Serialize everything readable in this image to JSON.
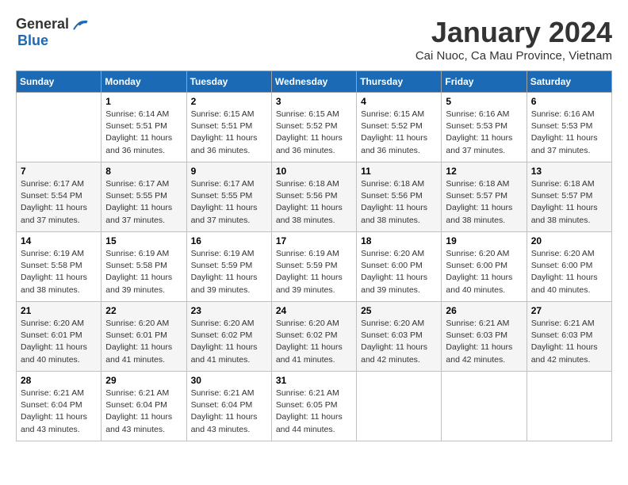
{
  "header": {
    "logo_general": "General",
    "logo_blue": "Blue",
    "month": "January 2024",
    "location": "Cai Nuoc, Ca Mau Province, Vietnam"
  },
  "days_of_week": [
    "Sunday",
    "Monday",
    "Tuesday",
    "Wednesday",
    "Thursday",
    "Friday",
    "Saturday"
  ],
  "weeks": [
    [
      {
        "day": "",
        "sunrise": "",
        "sunset": "",
        "daylight": ""
      },
      {
        "day": "1",
        "sunrise": "Sunrise: 6:14 AM",
        "sunset": "Sunset: 5:51 PM",
        "daylight": "Daylight: 11 hours and 36 minutes."
      },
      {
        "day": "2",
        "sunrise": "Sunrise: 6:15 AM",
        "sunset": "Sunset: 5:51 PM",
        "daylight": "Daylight: 11 hours and 36 minutes."
      },
      {
        "day": "3",
        "sunrise": "Sunrise: 6:15 AM",
        "sunset": "Sunset: 5:52 PM",
        "daylight": "Daylight: 11 hours and 36 minutes."
      },
      {
        "day": "4",
        "sunrise": "Sunrise: 6:15 AM",
        "sunset": "Sunset: 5:52 PM",
        "daylight": "Daylight: 11 hours and 36 minutes."
      },
      {
        "day": "5",
        "sunrise": "Sunrise: 6:16 AM",
        "sunset": "Sunset: 5:53 PM",
        "daylight": "Daylight: 11 hours and 37 minutes."
      },
      {
        "day": "6",
        "sunrise": "Sunrise: 6:16 AM",
        "sunset": "Sunset: 5:53 PM",
        "daylight": "Daylight: 11 hours and 37 minutes."
      }
    ],
    [
      {
        "day": "7",
        "sunrise": "Sunrise: 6:17 AM",
        "sunset": "Sunset: 5:54 PM",
        "daylight": "Daylight: 11 hours and 37 minutes."
      },
      {
        "day": "8",
        "sunrise": "Sunrise: 6:17 AM",
        "sunset": "Sunset: 5:55 PM",
        "daylight": "Daylight: 11 hours and 37 minutes."
      },
      {
        "day": "9",
        "sunrise": "Sunrise: 6:17 AM",
        "sunset": "Sunset: 5:55 PM",
        "daylight": "Daylight: 11 hours and 37 minutes."
      },
      {
        "day": "10",
        "sunrise": "Sunrise: 6:18 AM",
        "sunset": "Sunset: 5:56 PM",
        "daylight": "Daylight: 11 hours and 38 minutes."
      },
      {
        "day": "11",
        "sunrise": "Sunrise: 6:18 AM",
        "sunset": "Sunset: 5:56 PM",
        "daylight": "Daylight: 11 hours and 38 minutes."
      },
      {
        "day": "12",
        "sunrise": "Sunrise: 6:18 AM",
        "sunset": "Sunset: 5:57 PM",
        "daylight": "Daylight: 11 hours and 38 minutes."
      },
      {
        "day": "13",
        "sunrise": "Sunrise: 6:18 AM",
        "sunset": "Sunset: 5:57 PM",
        "daylight": "Daylight: 11 hours and 38 minutes."
      }
    ],
    [
      {
        "day": "14",
        "sunrise": "Sunrise: 6:19 AM",
        "sunset": "Sunset: 5:58 PM",
        "daylight": "Daylight: 11 hours and 38 minutes."
      },
      {
        "day": "15",
        "sunrise": "Sunrise: 6:19 AM",
        "sunset": "Sunset: 5:58 PM",
        "daylight": "Daylight: 11 hours and 39 minutes."
      },
      {
        "day": "16",
        "sunrise": "Sunrise: 6:19 AM",
        "sunset": "Sunset: 5:59 PM",
        "daylight": "Daylight: 11 hours and 39 minutes."
      },
      {
        "day": "17",
        "sunrise": "Sunrise: 6:19 AM",
        "sunset": "Sunset: 5:59 PM",
        "daylight": "Daylight: 11 hours and 39 minutes."
      },
      {
        "day": "18",
        "sunrise": "Sunrise: 6:20 AM",
        "sunset": "Sunset: 6:00 PM",
        "daylight": "Daylight: 11 hours and 39 minutes."
      },
      {
        "day": "19",
        "sunrise": "Sunrise: 6:20 AM",
        "sunset": "Sunset: 6:00 PM",
        "daylight": "Daylight: 11 hours and 40 minutes."
      },
      {
        "day": "20",
        "sunrise": "Sunrise: 6:20 AM",
        "sunset": "Sunset: 6:00 PM",
        "daylight": "Daylight: 11 hours and 40 minutes."
      }
    ],
    [
      {
        "day": "21",
        "sunrise": "Sunrise: 6:20 AM",
        "sunset": "Sunset: 6:01 PM",
        "daylight": "Daylight: 11 hours and 40 minutes."
      },
      {
        "day": "22",
        "sunrise": "Sunrise: 6:20 AM",
        "sunset": "Sunset: 6:01 PM",
        "daylight": "Daylight: 11 hours and 41 minutes."
      },
      {
        "day": "23",
        "sunrise": "Sunrise: 6:20 AM",
        "sunset": "Sunset: 6:02 PM",
        "daylight": "Daylight: 11 hours and 41 minutes."
      },
      {
        "day": "24",
        "sunrise": "Sunrise: 6:20 AM",
        "sunset": "Sunset: 6:02 PM",
        "daylight": "Daylight: 11 hours and 41 minutes."
      },
      {
        "day": "25",
        "sunrise": "Sunrise: 6:20 AM",
        "sunset": "Sunset: 6:03 PM",
        "daylight": "Daylight: 11 hours and 42 minutes."
      },
      {
        "day": "26",
        "sunrise": "Sunrise: 6:21 AM",
        "sunset": "Sunset: 6:03 PM",
        "daylight": "Daylight: 11 hours and 42 minutes."
      },
      {
        "day": "27",
        "sunrise": "Sunrise: 6:21 AM",
        "sunset": "Sunset: 6:03 PM",
        "daylight": "Daylight: 11 hours and 42 minutes."
      }
    ],
    [
      {
        "day": "28",
        "sunrise": "Sunrise: 6:21 AM",
        "sunset": "Sunset: 6:04 PM",
        "daylight": "Daylight: 11 hours and 43 minutes."
      },
      {
        "day": "29",
        "sunrise": "Sunrise: 6:21 AM",
        "sunset": "Sunset: 6:04 PM",
        "daylight": "Daylight: 11 hours and 43 minutes."
      },
      {
        "day": "30",
        "sunrise": "Sunrise: 6:21 AM",
        "sunset": "Sunset: 6:04 PM",
        "daylight": "Daylight: 11 hours and 43 minutes."
      },
      {
        "day": "31",
        "sunrise": "Sunrise: 6:21 AM",
        "sunset": "Sunset: 6:05 PM",
        "daylight": "Daylight: 11 hours and 44 minutes."
      },
      {
        "day": "",
        "sunrise": "",
        "sunset": "",
        "daylight": ""
      },
      {
        "day": "",
        "sunrise": "",
        "sunset": "",
        "daylight": ""
      },
      {
        "day": "",
        "sunrise": "",
        "sunset": "",
        "daylight": ""
      }
    ]
  ]
}
